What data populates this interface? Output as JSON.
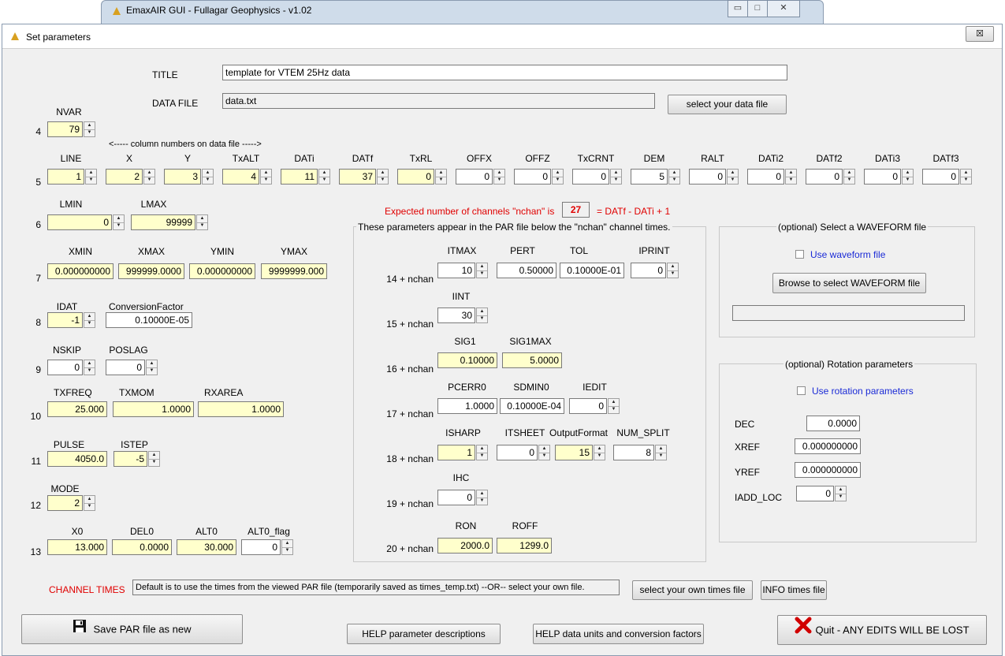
{
  "bg_window": {
    "title": "EmaxAIR GUI - Fullagar Geophysics - v1.02"
  },
  "window": {
    "title": "Set parameters",
    "close": "☒"
  },
  "title_row": {
    "label": "TITLE",
    "value": "template for VTEM 25Hz data"
  },
  "datafile_row": {
    "label": "DATA FILE",
    "value": "data.txt",
    "button": "select your data file"
  },
  "row4": {
    "num": "4",
    "header": "NVAR",
    "value": "79",
    "note": "<----- column numbers on data file ----->"
  },
  "row5": {
    "num": "5",
    "items": [
      {
        "h": "LINE",
        "v": "1"
      },
      {
        "h": "X",
        "v": "2"
      },
      {
        "h": "Y",
        "v": "3"
      },
      {
        "h": "TxALT",
        "v": "4"
      },
      {
        "h": "DATi",
        "v": "11"
      },
      {
        "h": "DATf",
        "v": "37"
      },
      {
        "h": "TxRL",
        "v": "0"
      },
      {
        "h": "OFFX",
        "v": "0"
      },
      {
        "h": "OFFZ",
        "v": "0"
      },
      {
        "h": "TxCRNT",
        "v": "0"
      },
      {
        "h": "DEM",
        "v": "5"
      },
      {
        "h": "RALT",
        "v": "0"
      },
      {
        "h": "DATi2",
        "v": "0"
      },
      {
        "h": "DATf2",
        "v": "0"
      },
      {
        "h": "DATi3",
        "v": "0"
      },
      {
        "h": "DATf3",
        "v": "0"
      }
    ]
  },
  "row6": {
    "num": "6",
    "lmin_h": "LMIN",
    "lmin": "0",
    "lmax_h": "LMAX",
    "lmax": "99999"
  },
  "nchan": {
    "prefix": "Expected number of channels \"nchan\" is",
    "value": "27",
    "suffix": "= DATf - DATi + 1"
  },
  "row7": {
    "num": "7",
    "items": [
      {
        "h": "XMIN",
        "v": "0.000000000"
      },
      {
        "h": "XMAX",
        "v": "999999.0000"
      },
      {
        "h": "YMIN",
        "v": "0.000000000"
      },
      {
        "h": "YMAX",
        "v": "9999999.000"
      }
    ]
  },
  "row8": {
    "num": "8",
    "idat_h": "IDAT",
    "idat": "-1",
    "cf_h": "ConversionFactor",
    "cf": "0.10000E-05"
  },
  "row9": {
    "num": "9",
    "nskip_h": "NSKIP",
    "nskip": "0",
    "poslag_h": "POSLAG",
    "poslag": "0"
  },
  "row10": {
    "num": "10",
    "items": [
      {
        "h": "TXFREQ",
        "v": "25.000"
      },
      {
        "h": "TXMOM",
        "v": "1.0000"
      },
      {
        "h": "RXAREA",
        "v": "1.0000"
      }
    ]
  },
  "row11": {
    "num": "11",
    "pulse_h": "PULSE",
    "pulse": "4050.0",
    "istep_h": "ISTEP",
    "istep": "-5"
  },
  "row12": {
    "num": "12",
    "mode_h": "MODE",
    "mode": "2"
  },
  "row13": {
    "num": "13",
    "items": [
      {
        "h": "X0",
        "v": "13.000"
      },
      {
        "h": "DEL0",
        "v": "0.0000"
      },
      {
        "h": "ALT0",
        "v": "30.000"
      },
      {
        "h": "ALT0_flag",
        "v": "0"
      }
    ]
  },
  "par_group": {
    "title": "These parameters appear in the PAR file below the \"nchan\" channel times.",
    "r14": {
      "num": "14 + nchan",
      "itmax_h": "ITMAX",
      "itmax": "10",
      "pert_h": "PERT",
      "pert": "0.50000",
      "tol_h": "TOL",
      "tol": "0.10000E-01",
      "iprint_h": "IPRINT",
      "iprint": "0"
    },
    "r15": {
      "num": "15 + nchan",
      "iint_h": "IINT",
      "iint": "30"
    },
    "r16": {
      "num": "16 + nchan",
      "sig1_h": "SIG1",
      "sig1": "0.10000",
      "sig1max_h": "SIG1MAX",
      "sig1max": "5.0000"
    },
    "r17": {
      "num": "17 + nchan",
      "pcerr0_h": "PCERR0",
      "pcerr0": "1.0000",
      "sdmin0_h": "SDMIN0",
      "sdmin0": "0.10000E-04",
      "iedit_h": "IEDIT",
      "iedit": "0"
    },
    "r18": {
      "num": "18 + nchan",
      "isharp_h": "ISHARP",
      "isharp": "1",
      "itsheet_h": "ITSHEET",
      "itsheet": "0",
      "of_h": "OutputFormat",
      "of": "15",
      "ns_h": "NUM_SPLIT",
      "ns": "8"
    },
    "r19": {
      "num": "19 + nchan",
      "ihc_h": "IHC",
      "ihc": "0"
    },
    "r20": {
      "num": "20 + nchan",
      "ron_h": "RON",
      "ron": "2000.0",
      "roff_h": "ROFF",
      "roff": "1299.0"
    }
  },
  "waveform": {
    "title": "(optional) Select a WAVEFORM file",
    "checkbox": "Use waveform file",
    "button": "Browse to select WAVEFORM file",
    "path": ""
  },
  "rotation": {
    "title": "(optional) Rotation parameters",
    "checkbox": "Use rotation parameters",
    "dec_h": "DEC",
    "dec": "0.0000",
    "xref_h": "XREF",
    "xref": "0.000000000",
    "yref_h": "YREF",
    "yref": "0.000000000",
    "iadd_h": "IADD_LOC",
    "iadd": "0"
  },
  "channel_times": {
    "label": "CHANNEL TIMES",
    "value": "Default is to use the times from the viewed PAR file (temporarily saved as times_temp.txt) --OR-- select your own file.",
    "select_button": "select your own times file",
    "info_button": "INFO times file"
  },
  "footer": {
    "save": "Save PAR file as new",
    "help1": "HELP parameter descriptions",
    "help2": "HELP data units and conversion factors",
    "quit": "Quit - ANY EDITS WILL BE LOST"
  },
  "colors": {
    "red": "#e00000",
    "blue": "#1a2ad6",
    "yellow": "#ffffcc"
  }
}
